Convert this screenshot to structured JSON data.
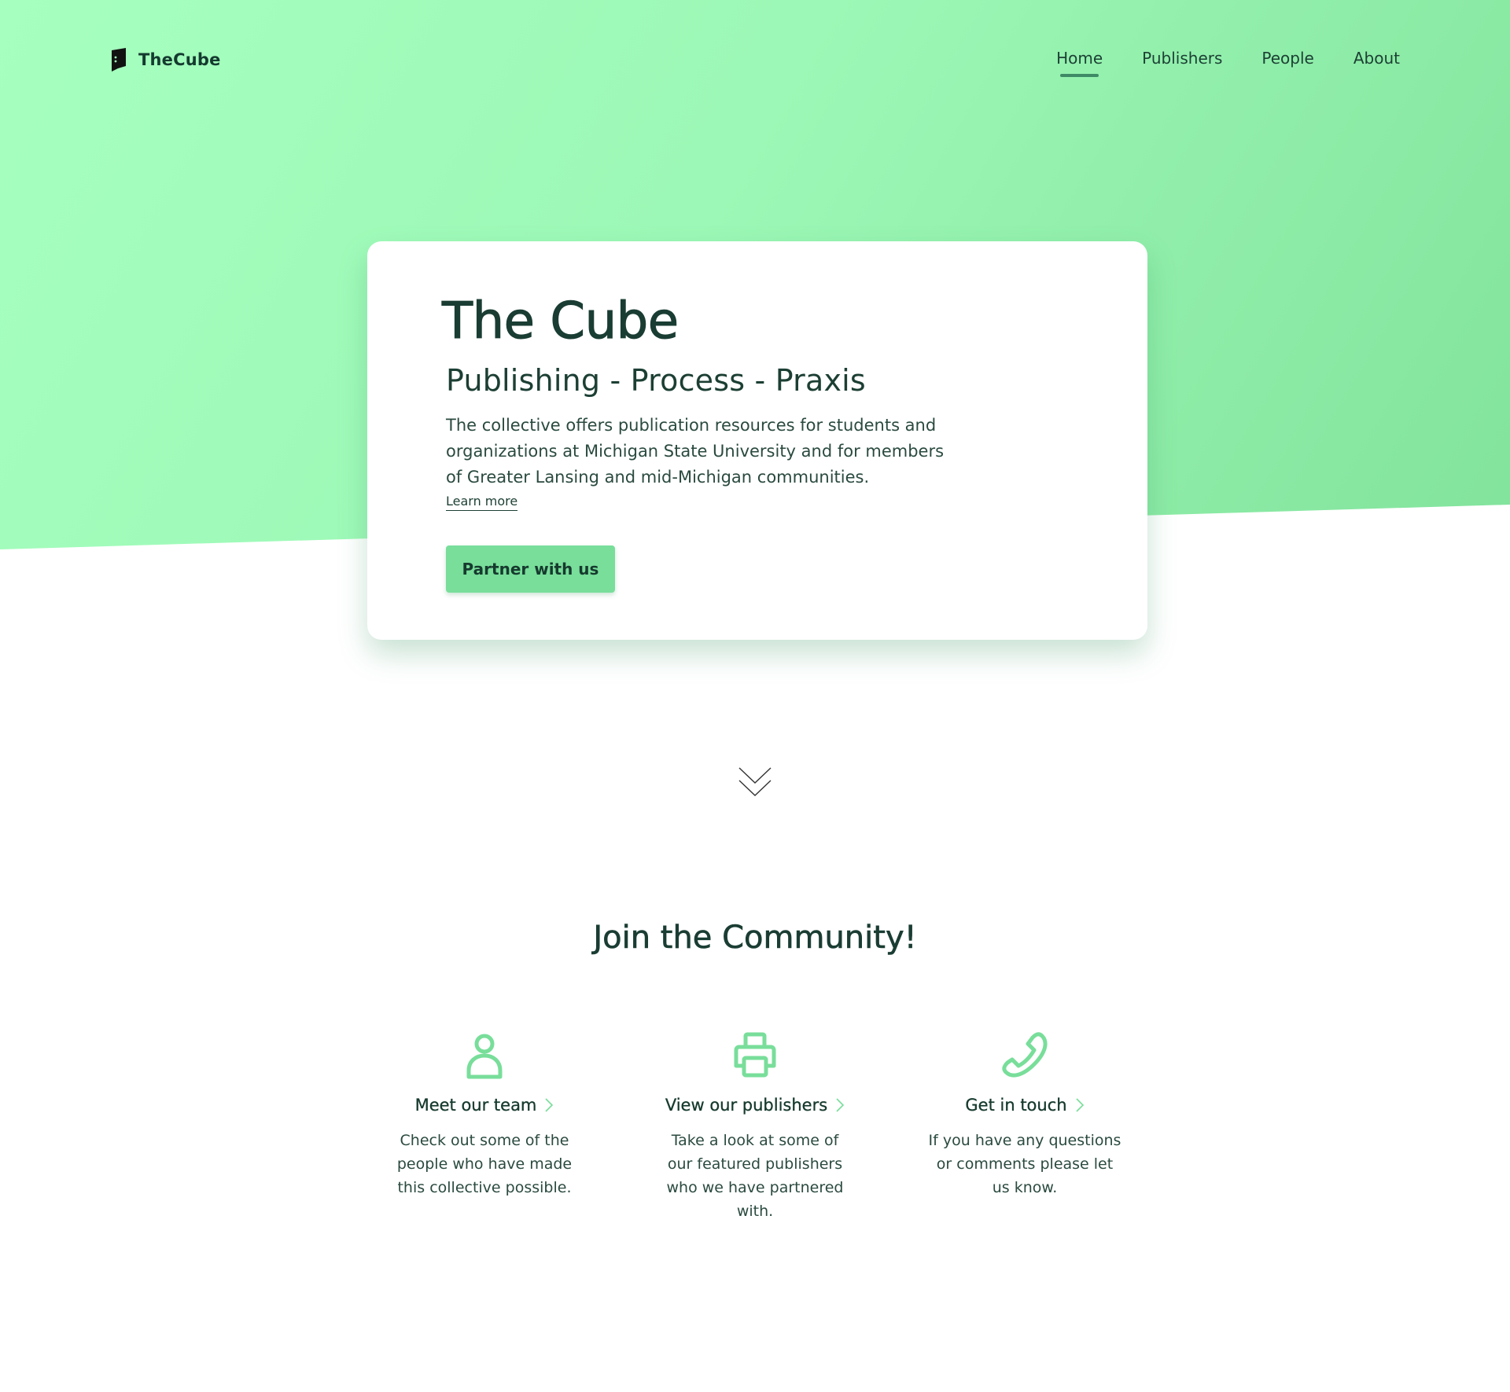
{
  "brand": {
    "name": "TheCube",
    "logo_icon": "cube-logo-icon"
  },
  "nav": {
    "items": [
      {
        "label": "Home",
        "active": true
      },
      {
        "label": "Publishers",
        "active": false
      },
      {
        "label": "People",
        "active": false
      },
      {
        "label": "About",
        "active": false
      }
    ]
  },
  "hero": {
    "title": "The Cube",
    "subtitle": "Publishing - Process - Praxis",
    "description": "The collective offers publication resources for students and organizations at Michigan State University and for members of Greater Lansing and mid-Michigan communities.",
    "learn_more": "Learn more",
    "cta": "Partner with us"
  },
  "scroll_icon": "double-chevron-down-icon",
  "community": {
    "title": "Join the Community!",
    "features": [
      {
        "icon": "person-icon",
        "link": "Meet our team",
        "description": "Check out some of the people who have made this collective possible."
      },
      {
        "icon": "printer-icon",
        "link": "View our publishers",
        "description": "Take a look at some of our featured publishers who we have partnered with."
      },
      {
        "icon": "phone-icon",
        "link": "Get in touch",
        "description": "If you have any questions or comments please let us know."
      }
    ]
  },
  "colors": {
    "hero_gradient_start": "#a6ffbf",
    "hero_gradient_end": "#82e39c",
    "accent": "#78de9a",
    "text_dark": "#1a3d33",
    "nav_active_underline": "#3f8a66"
  }
}
